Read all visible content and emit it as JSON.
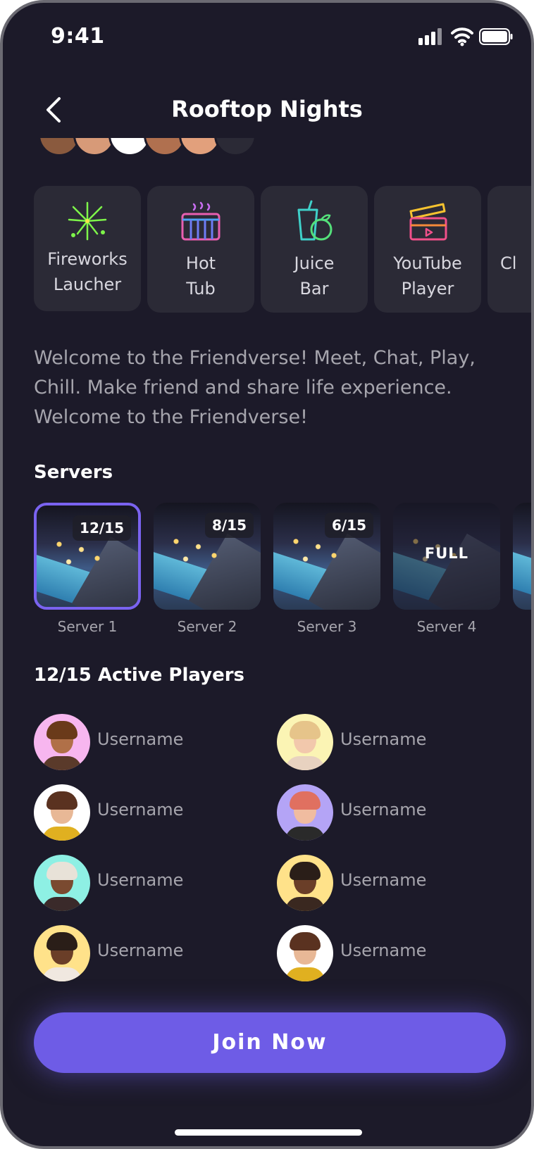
{
  "status_bar": {
    "time": "9:41"
  },
  "header": {
    "title": "Rooftop Nights"
  },
  "activities": [
    {
      "label_line1": "Fireworks",
      "label_line2": "Laucher",
      "icon": "fireworks-icon"
    },
    {
      "label_line1": "Hot",
      "label_line2": "Tub",
      "icon": "hot-tub-icon"
    },
    {
      "label_line1": "Juice",
      "label_line2": "Bar",
      "icon": "juice-bar-icon"
    },
    {
      "label_line1": "YouTube",
      "label_line2": "Player",
      "icon": "clapperboard-icon"
    },
    {
      "label_line1": "",
      "label_line2": "Cl",
      "icon": "partial-icon"
    }
  ],
  "description": "Welcome to the Friendverse! Meet, Chat, Play, Chill. Make friend and share life experience. Welcome to the Friendverse!",
  "servers_section": {
    "title": "Servers"
  },
  "servers": [
    {
      "name": "Server 1",
      "count": "12/15",
      "selected": true
    },
    {
      "name": "Server 2",
      "count": "8/15",
      "selected": false
    },
    {
      "name": "Server 3",
      "count": "6/15",
      "selected": false
    },
    {
      "name": "Server 4",
      "count": "FULL",
      "selected": false
    }
  ],
  "players_section": {
    "title": "12/15 Active Players"
  },
  "players": [
    {
      "username": "Username",
      "bg": "#f7b6ef"
    },
    {
      "username": "Username",
      "bg": "#fbf4b4"
    },
    {
      "username": "Username",
      "bg": "#ffffff"
    },
    {
      "username": "Username",
      "bg": "#b4a4f6"
    },
    {
      "username": "Username",
      "bg": "#8ef0e4"
    },
    {
      "username": "Username",
      "bg": "#ffe28a"
    },
    {
      "username": "Username",
      "bg": "#ffe28a"
    },
    {
      "username": "Username",
      "bg": "#ffffff"
    }
  ],
  "cta": {
    "label": "Join Now"
  },
  "colors": {
    "background": "#1c1a29",
    "card": "#2b2a36",
    "accent": "#6e5ce6",
    "muted_text": "#a6a5ad"
  }
}
